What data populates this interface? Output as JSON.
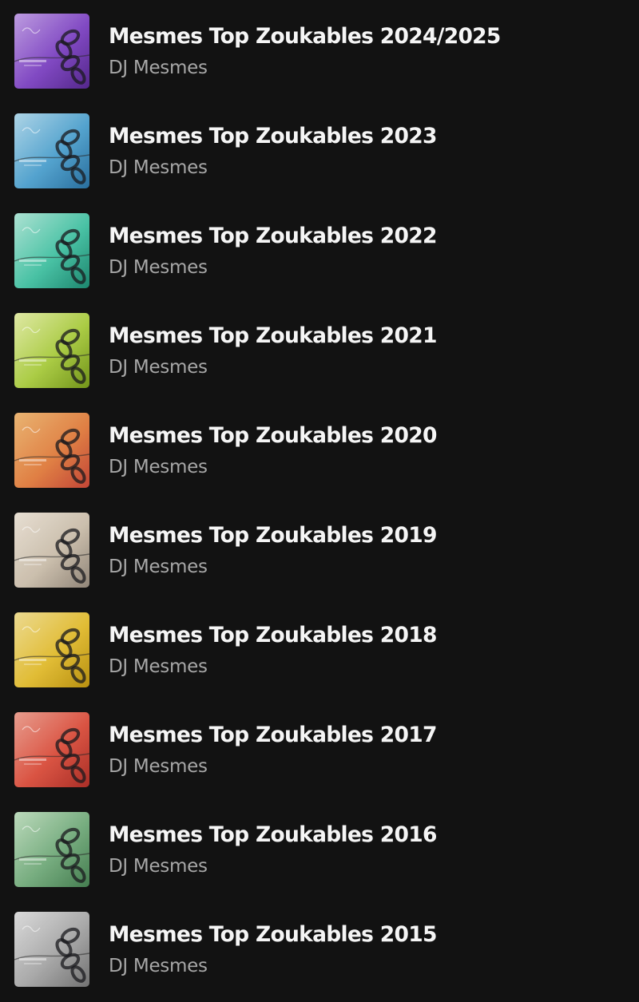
{
  "albums": [
    {
      "title": "Mesmes Top Zoukables 2024/2025",
      "artist": "DJ Mesmes",
      "cover": {
        "colors": [
          "#c9a6ee",
          "#8a4fd0",
          "#5a2a95"
        ],
        "icon": "album-cover-chain-icon"
      }
    },
    {
      "title": "Mesmes Top Zoukables 2023",
      "artist": "DJ Mesmes",
      "cover": {
        "colors": [
          "#b9e2f5",
          "#5aaedc",
          "#2c76a8"
        ],
        "icon": "album-cover-chain-icon"
      }
    },
    {
      "title": "Mesmes Top Zoukables 2022",
      "artist": "DJ Mesmes",
      "cover": {
        "colors": [
          "#b8f0e0",
          "#4fcfb0",
          "#1f8f76"
        ],
        "icon": "album-cover-chain-icon"
      }
    },
    {
      "title": "Mesmes Top Zoukables 2021",
      "artist": "DJ Mesmes",
      "cover": {
        "colors": [
          "#eef8b0",
          "#b6d94a",
          "#7a9e1c"
        ],
        "icon": "album-cover-chain-icon"
      }
    },
    {
      "title": "Mesmes Top Zoukables 2020",
      "artist": "DJ Mesmes",
      "cover": {
        "colors": [
          "#f8c07a",
          "#ef8a4a",
          "#cf4a3a"
        ],
        "icon": "album-cover-chain-icon"
      }
    },
    {
      "title": "Mesmes Top Zoukables 2019",
      "artist": "DJ Mesmes",
      "cover": {
        "colors": [
          "#f6ede0",
          "#d8cbb8",
          "#9a8e80"
        ],
        "icon": "album-cover-chain-icon"
      }
    },
    {
      "title": "Mesmes Top Zoukables 2018",
      "artist": "DJ Mesmes",
      "cover": {
        "colors": [
          "#fbe89a",
          "#f0c93a",
          "#c49a12"
        ],
        "icon": "album-cover-chain-icon"
      }
    },
    {
      "title": "Mesmes Top Zoukables 2017",
      "artist": "DJ Mesmes",
      "cover": {
        "colors": [
          "#f7a898",
          "#e85a48",
          "#b5322a"
        ],
        "icon": "album-cover-chain-icon"
      }
    },
    {
      "title": "Mesmes Top Zoukables 2016",
      "artist": "DJ Mesmes",
      "cover": {
        "colors": [
          "#c8e8c8",
          "#7fb888",
          "#4a8656"
        ],
        "icon": "album-cover-chain-icon"
      }
    },
    {
      "title": "Mesmes Top Zoukables 2015",
      "artist": "DJ Mesmes",
      "cover": {
        "colors": [
          "#e8e8e8",
          "#b4b4b4",
          "#7a7a7a"
        ],
        "icon": "album-cover-chain-icon"
      }
    }
  ]
}
